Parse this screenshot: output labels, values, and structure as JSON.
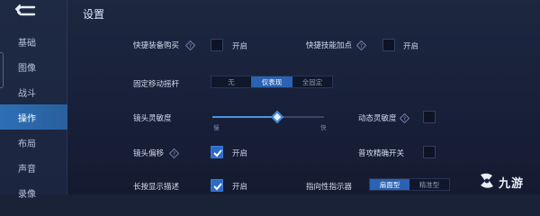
{
  "header": {
    "title": "设置"
  },
  "sidebar": {
    "items": [
      {
        "label": "基础"
      },
      {
        "label": "图像"
      },
      {
        "label": "战斗"
      },
      {
        "label": "操作"
      },
      {
        "label": "布局"
      },
      {
        "label": "声音"
      },
      {
        "label": "录像"
      }
    ],
    "active_index": 3
  },
  "settings": {
    "quick_buy": {
      "label": "快捷装备购买",
      "checked": false,
      "option_label": "开启"
    },
    "quick_skill": {
      "label": "快捷技能加点",
      "checked": false,
      "option_label": "开启"
    },
    "fixed_joystick": {
      "label": "固定移动摇杆",
      "options": [
        "无",
        "仅表现",
        "全固定"
      ],
      "selected": "仅表现"
    },
    "camera_sensitivity": {
      "label": "镜头灵敏度",
      "value_fraction": 0.58,
      "min_label": "慢",
      "max_label": "快"
    },
    "dynamic_sensitivity": {
      "label": "动态灵敏度",
      "checked": false
    },
    "camera_offset": {
      "label": "镜头偏移",
      "checked": true,
      "option_label": "开启"
    },
    "basic_attack_precision": {
      "label": "普攻精确开关",
      "checked": false
    },
    "long_press_desc": {
      "label": "长按显示描述",
      "checked": true,
      "option_label": "开启"
    },
    "directional_indicator": {
      "label": "指向性指示器",
      "options": [
        "扇面型",
        "精准型"
      ],
      "selected": "扇面型"
    }
  },
  "watermark": {
    "text": "九游"
  },
  "colors": {
    "accent": "#2d6fb5",
    "background": "#1a2238",
    "checked": "#2d6bc2"
  }
}
